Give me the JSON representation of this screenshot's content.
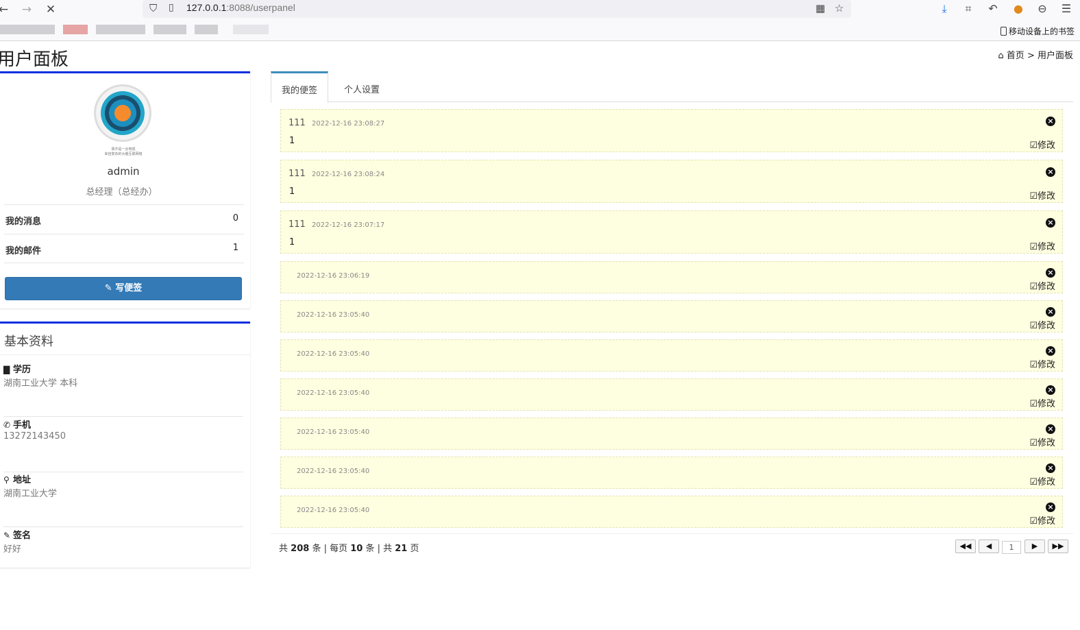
{
  "browser": {
    "url_host": "127.0.0.1",
    "url_rest": ":8088/userpanel",
    "mobile_bookmarks": "移动设备上的书签"
  },
  "page": {
    "title": "用户面板",
    "breadcrumb_home": "首页",
    "breadcrumb_sep": ">",
    "breadcrumb_current": "用户面板"
  },
  "profile": {
    "name": "admin",
    "role": "总经理（总经办）",
    "avatar_caption": "我不是一台电视\n来自复杂的大脑互联网络",
    "stats": [
      {
        "label": "我的消息",
        "value": "0"
      },
      {
        "label": "我的邮件",
        "value": "1"
      }
    ],
    "write_button": "写便签"
  },
  "basic": {
    "title": "基本资料",
    "items": [
      {
        "icon": "book-icon",
        "label": "学历",
        "value": "湖南工业大学 本科"
      },
      {
        "icon": "phone-icon",
        "label": "手机",
        "value": "13272143450"
      },
      {
        "icon": "map-marker-icon",
        "label": "地址",
        "value": "湖南工业大学"
      },
      {
        "icon": "pencil-icon",
        "label": "签名",
        "value": "好好"
      }
    ]
  },
  "tabs": [
    {
      "label": "我的便签",
      "active": true
    },
    {
      "label": "个人设置",
      "active": false
    }
  ],
  "notes": [
    {
      "title": "111",
      "time": "2022-12-16 23:08:27",
      "content": "1"
    },
    {
      "title": "111",
      "time": "2022-12-16 23:08:24",
      "content": "1"
    },
    {
      "title": "111",
      "time": "2022-12-16 23:07:17",
      "content": "1"
    },
    {
      "title": "",
      "time": "2022-12-16 23:06:19",
      "content": ""
    },
    {
      "title": "",
      "time": "2022-12-16 23:05:40",
      "content": ""
    },
    {
      "title": "",
      "time": "2022-12-16 23:05:40",
      "content": ""
    },
    {
      "title": "",
      "time": "2022-12-16 23:05:40",
      "content": ""
    },
    {
      "title": "",
      "time": "2022-12-16 23:05:40",
      "content": ""
    },
    {
      "title": "",
      "time": "2022-12-16 23:05:40",
      "content": ""
    },
    {
      "title": "",
      "time": "2022-12-16 23:05:40",
      "content": ""
    }
  ],
  "note_edit_label": "修改",
  "pager": {
    "total_prefix": "共",
    "total": "208",
    "total_suffix": "条 | 每页",
    "per_page": "10",
    "per_page_suffix": "条 | 共",
    "pages": "21",
    "pages_suffix": "页",
    "current_page": "1"
  },
  "colors": {
    "accent_border": "#0a2ee0",
    "primary_button": "#337ab7",
    "note_bg": "#fefee0"
  }
}
